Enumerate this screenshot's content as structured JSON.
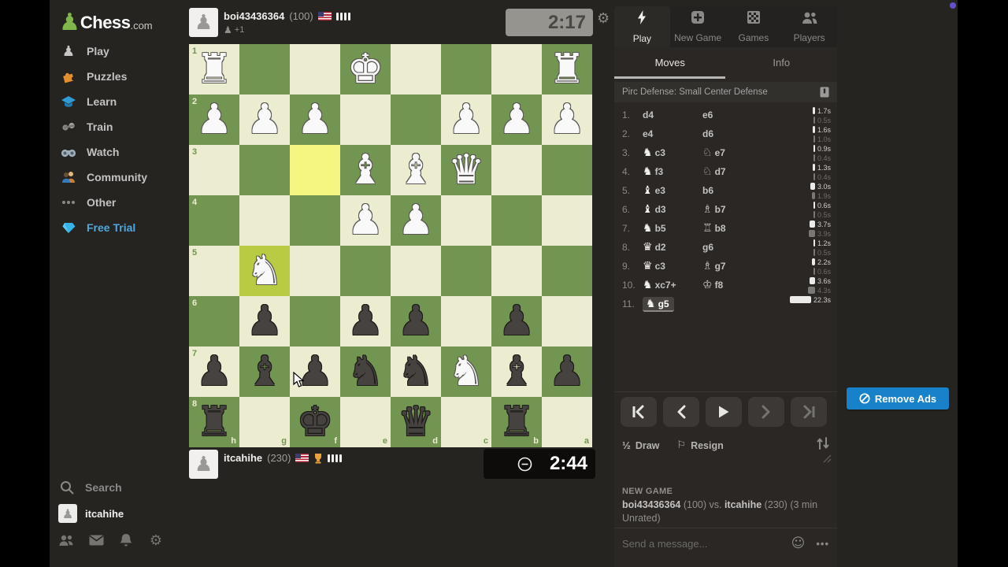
{
  "page": {
    "remove_ads_label": "Remove Ads"
  },
  "sidebar": {
    "logo": {
      "main": "Chess",
      "suffix": ".com"
    },
    "items": [
      {
        "id": "play",
        "label": "Play",
        "icon": "play-hand-pawn-icon"
      },
      {
        "id": "puzzles",
        "label": "Puzzles",
        "icon": "puzzle-piece-icon"
      },
      {
        "id": "learn",
        "label": "Learn",
        "icon": "graduation-cap-icon"
      },
      {
        "id": "train",
        "label": "Train",
        "icon": "dumbbell-icon"
      },
      {
        "id": "watch",
        "label": "Watch",
        "icon": "binoculars-icon"
      },
      {
        "id": "community",
        "label": "Community",
        "icon": "community-people-icon"
      },
      {
        "id": "other",
        "label": "Other",
        "icon": "ellipsis-icon"
      },
      {
        "id": "free-trial",
        "label": "Free Trial",
        "icon": "diamond-icon",
        "accent": true
      }
    ],
    "search_label": "Search",
    "username": "itcahihe"
  },
  "players": {
    "top": {
      "name": "boi43436364",
      "rating": "(100)",
      "flag": "us-flag-icon",
      "captured_pawns": "+1",
      "clock": "2:17",
      "clock_active": false
    },
    "bottom": {
      "name": "itcahihe",
      "rating": "(230)",
      "flag": "us-flag-icon",
      "badge": "trophy-icon",
      "clock": "2:44",
      "clock_active": true
    }
  },
  "board": {
    "orientation": "black",
    "files": [
      "h",
      "g",
      "f",
      "e",
      "d",
      "c",
      "b",
      "a"
    ],
    "ranks": [
      1,
      2,
      3,
      4,
      5,
      6,
      7,
      8
    ],
    "pieces": {
      "h1": "wR",
      "e1": "wK",
      "a1": "wR",
      "h2": "wP",
      "g2": "wP",
      "f2": "wP",
      "c2": "wP",
      "b2": "wP",
      "a2": "wP",
      "e3": "wB",
      "d3": "wB",
      "c3": "wQ",
      "e4": "wP",
      "d4": "wP",
      "g5": "wN",
      "g6": "bP",
      "e6": "bP",
      "d6": "bP",
      "b6": "bP",
      "h7": "bP",
      "g7": "bB",
      "f7": "bP",
      "e7": "bN",
      "d7": "bN",
      "c7": "wN",
      "b7": "bB",
      "a7": "bP",
      "h8": "bR",
      "f8": "bK",
      "d8": "bQ",
      "b8": "bR"
    },
    "highlights": [
      "f3",
      "g5"
    ],
    "colors": {
      "light": "#ebecd0",
      "dark": "#739552",
      "highlight_light": "#f5f682",
      "highlight_dark": "#b9ca43"
    }
  },
  "right_panel": {
    "tabs": [
      {
        "label": "Play",
        "icon": "lightning-icon",
        "active": true
      },
      {
        "label": "New Game",
        "icon": "plus-square-icon",
        "active": false
      },
      {
        "label": "Games",
        "icon": "checkerboard-icon",
        "active": false
      },
      {
        "label": "Players",
        "icon": "players-icon",
        "active": false
      }
    ],
    "subtabs": [
      {
        "label": "Moves",
        "active": true
      },
      {
        "label": "Info",
        "active": false
      }
    ],
    "opening": "Pirc Defense: Small Center Defense",
    "moves": [
      {
        "n": "1.",
        "w": "d4",
        "b": "e6",
        "wt": "1.7s",
        "bt": "0.5s",
        "wv": 1.7,
        "bv": 0.5
      },
      {
        "n": "2.",
        "w": "e4",
        "b": "d6",
        "wt": "1.6s",
        "bt": "1.0s",
        "wv": 1.6,
        "bv": 1.0
      },
      {
        "n": "3.",
        "wp": "N",
        "w": "c3",
        "bp": "n",
        "b": "e7",
        "wt": "0.9s",
        "bt": "0.4s",
        "wv": 0.9,
        "bv": 0.4
      },
      {
        "n": "4.",
        "wp": "N",
        "w": "f3",
        "bp": "n",
        "b": "d7",
        "wt": "1.3s",
        "bt": "0.4s",
        "wv": 1.3,
        "bv": 0.4
      },
      {
        "n": "5.",
        "wp": "B",
        "w": "e3",
        "b": "b6",
        "wt": "3.0s",
        "bt": "1.9s",
        "wv": 3.0,
        "bv": 1.9
      },
      {
        "n": "6.",
        "wp": "B",
        "w": "d3",
        "bp": "b",
        "b": "b7",
        "wt": "0.6s",
        "bt": "0.5s",
        "wv": 0.6,
        "bv": 0.5
      },
      {
        "n": "7.",
        "wp": "N",
        "w": "b5",
        "bp": "r",
        "b": "b8",
        "wt": "3.7s",
        "bt": "3.9s",
        "wv": 3.7,
        "bv": 3.9
      },
      {
        "n": "8.",
        "wp": "Q",
        "w": "d2",
        "b": "g6",
        "wt": "1.2s",
        "bt": "0.5s",
        "wv": 1.2,
        "bv": 0.5
      },
      {
        "n": "9.",
        "wp": "Q",
        "w": "c3",
        "bp": "b",
        "b": "g7",
        "wt": "2.2s",
        "bt": "0.6s",
        "wv": 2.2,
        "bv": 0.6
      },
      {
        "n": "10.",
        "wp": "N",
        "w": "xc7+",
        "bp": "k",
        "b": "f8",
        "wt": "3.6s",
        "bt": "4.3s",
        "wv": 3.6,
        "bv": 4.3
      },
      {
        "n": "11.",
        "wp": "N",
        "w": "g5",
        "current": true,
        "wt": "22.3s",
        "wv": 22.3
      }
    ],
    "controls": {
      "draw_fraction": "½",
      "draw": "Draw",
      "resign": "Resign"
    },
    "chat": {
      "header": "NEW GAME",
      "matchup": [
        {
          "t": "boi43436364",
          "bold": true
        },
        {
          "t": " (100) vs. ",
          "bold": false
        },
        {
          "t": "itcahihe",
          "bold": true
        },
        {
          "t": " (230) (3 min Unrated)",
          "bold": false
        }
      ],
      "placeholder": "Send a message..."
    }
  }
}
